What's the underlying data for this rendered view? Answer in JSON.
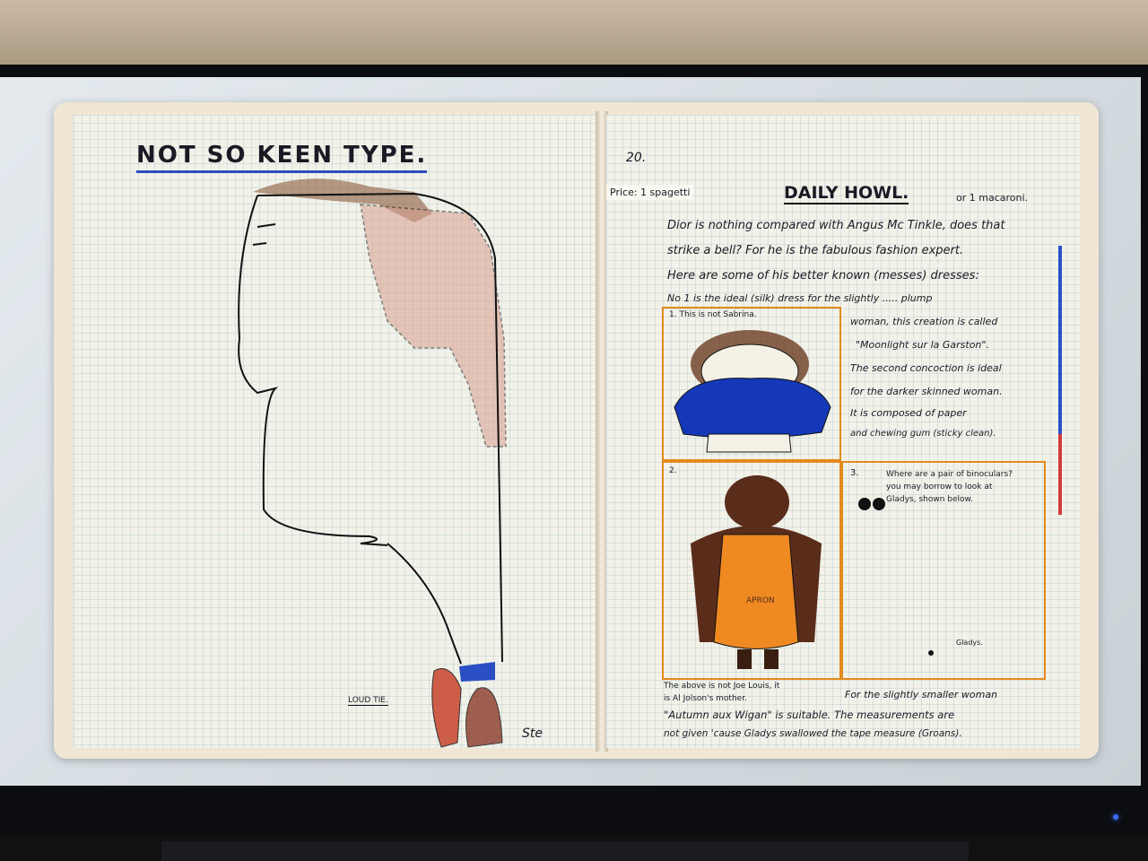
{
  "left_page": {
    "title": "NOT SO KEEN TYPE.",
    "tie_label": "LOUD TIE.",
    "signature": "Ste"
  },
  "right_page": {
    "page_number": "20.",
    "price": "Price: 1 spagetti",
    "masthead": "DAILY HOWL.",
    "masthead_aside": "or 1 macaroni.",
    "intro_lines": [
      "Dior is nothing compared with Angus Mc Tinkle, does that",
      "strike a bell? For he is the fabulous fashion expert.",
      "Here are some of his better known (messes) dresses:"
    ],
    "no1_line": "No 1 is the ideal (silk) dress for the slightly ..... plump",
    "panel1_caption": "1. This is not Sabrina.",
    "panel1_text": [
      "woman, this creation is called",
      "\"Moonlight sur la Garston\".",
      "The second concoction is ideal",
      "for the darker skinned woman.",
      "It is composed of paper",
      "and chewing gum (sticky clean)."
    ],
    "panel2_label": "2.",
    "panel3_label": "3.",
    "panel3_text": [
      "Where are a pair of binoculars?",
      "you may borrow to look at",
      "Gladys, shown below."
    ],
    "gladys_label": "Gladys.",
    "apron_text": "APRON",
    "panel2_caption": [
      "The above is not Joe Louis, it",
      "is Al Jolson's mother."
    ],
    "panel3_caption": "For the slightly smaller woman",
    "footer_lines": [
      "\"Autumn aux Wigan\" is suitable. The measurements are",
      "not given 'cause Gladys swallowed the tape measure (Groans)."
    ]
  },
  "colors": {
    "bezel": "#0c0d10",
    "screen": "#dde3e7",
    "grid_paper": "#f2f2e9",
    "panel_orange": "#e38a1c",
    "ink_blue": "#2a4ec4",
    "dress_blue": "#1438b8",
    "fur_brown": "#5a2c1a",
    "apron_orange": "#ef8a22"
  }
}
